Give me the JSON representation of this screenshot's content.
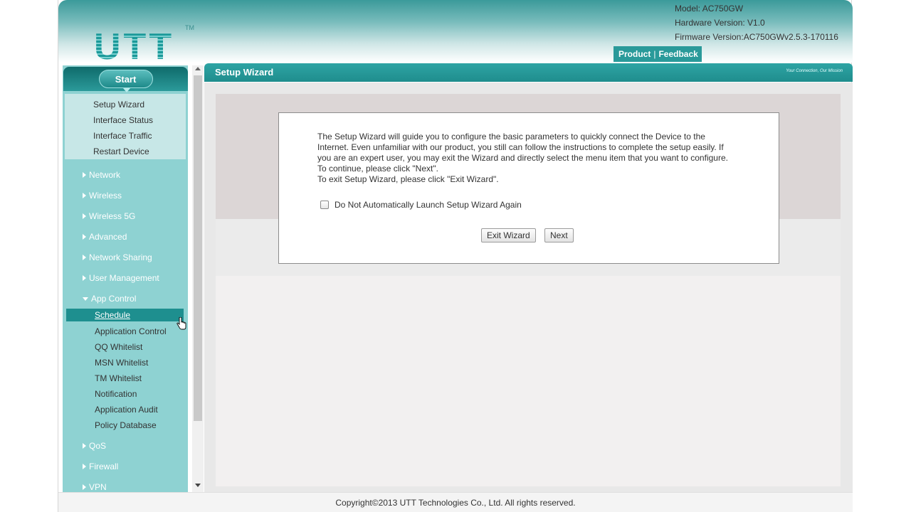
{
  "header": {
    "logo": "UTT",
    "logo_tm": "TM",
    "model": "Model: AC750GW",
    "hardware": "Hardware Version: V1.0",
    "firmware": "Firmware Version:AC750GWv2.5.3-170116",
    "product_link": "Product",
    "separator": "|",
    "feedback_link": "Feedback"
  },
  "sidebar": {
    "start_label": "Start",
    "quick_items": [
      {
        "label": "Setup Wizard"
      },
      {
        "label": "Interface Status"
      },
      {
        "label": "Interface Traffic"
      },
      {
        "label": "Restart Device"
      }
    ],
    "menu": [
      {
        "label": "Network"
      },
      {
        "label": "Wireless"
      },
      {
        "label": "Wireless 5G"
      },
      {
        "label": "Advanced"
      },
      {
        "label": "Network Sharing"
      },
      {
        "label": "User Management"
      },
      {
        "label": "App Control"
      },
      {
        "label": "QoS"
      },
      {
        "label": "Firewall"
      },
      {
        "label": "VPN"
      }
    ],
    "app_control_sub": [
      {
        "label": "Schedule"
      },
      {
        "label": "Application Control"
      },
      {
        "label": "QQ Whitelist"
      },
      {
        "label": "MSN Whitelist"
      },
      {
        "label": "TM Whitelist"
      },
      {
        "label": "Notification"
      },
      {
        "label": "Application Audit"
      },
      {
        "label": "Policy Database"
      }
    ],
    "selected": "Schedule"
  },
  "content": {
    "title": "Setup Wizard",
    "tagline": "Your Connection, Our Mission",
    "wizard": {
      "line1": "The Setup Wizard will guide you to configure the basic parameters to quickly connect the Device to the",
      "line2": "Internet. Even unfamiliar with our product, you still can follow the instructions to complete the setup easily. If",
      "line3": "you are an expert user, you may exit the Wizard and directly select the menu item that you want to configure.",
      "line4": "To continue, please click \"Next\".",
      "line5": "To exit Setup Wizard, please click \"Exit Wizard\".",
      "checkbox_label": "Do Not Automatically Launch Setup Wizard Again",
      "checkbox_checked": false,
      "exit_button": "Exit Wizard",
      "next_button": "Next"
    }
  },
  "footer": {
    "copyright": "Copyright©2013 UTT Technologies Co., Ltd. All rights reserved."
  },
  "colors": {
    "teal_dark": "#1f8d8d",
    "teal_sidebar": "#8ed2d2",
    "quick_box": "#c7e7e7"
  }
}
